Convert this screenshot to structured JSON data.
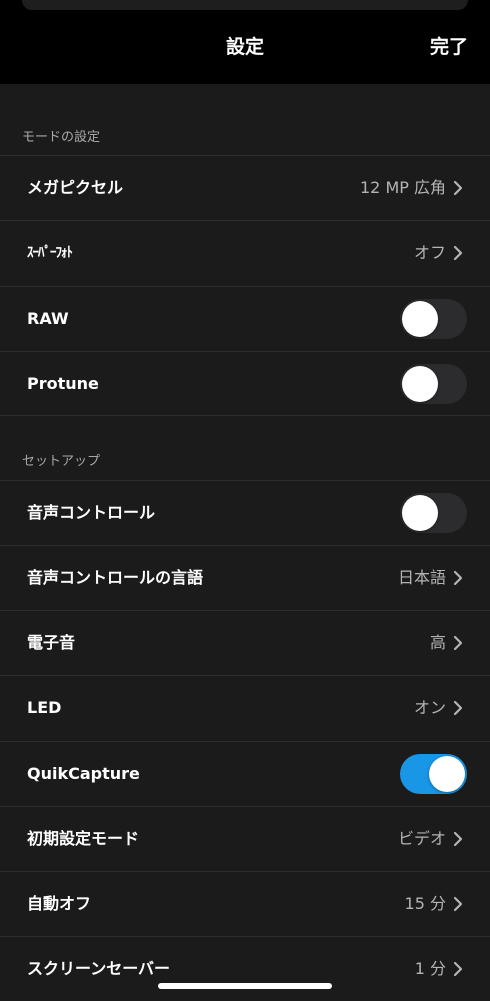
{
  "header": {
    "title": "設定",
    "done_label": "完了"
  },
  "sections": {
    "mode": {
      "title": "モードの設定",
      "rows": [
        {
          "label": "メガピクセル",
          "value": "12 MP 広角"
        },
        {
          "label": "ｽｰﾊﾟｰﾌｫﾄ",
          "value": "オフ"
        },
        {
          "label": "RAW",
          "toggle": false
        },
        {
          "label": "Protune",
          "toggle": false
        }
      ]
    },
    "setup": {
      "title": "セットアップ",
      "rows": [
        {
          "label": "音声コントロール",
          "toggle": false
        },
        {
          "label": "音声コントロールの言語",
          "value": "日本語"
        },
        {
          "label": "電子音",
          "value": "高"
        },
        {
          "label": "LED",
          "value": "オン"
        },
        {
          "label": "QuikCapture",
          "toggle": true
        },
        {
          "label": "初期設定モード",
          "value": "ビデオ"
        },
        {
          "label": "自動オフ",
          "value": "15 分"
        },
        {
          "label": "スクリーンセーバー",
          "value": "1 分"
        }
      ]
    }
  },
  "colors": {
    "background": "#1b1b1b",
    "header": "#000000",
    "toggle_on": "#1a96e6",
    "toggle_off": "#2c2c2e",
    "value_text": "#b4b4b4",
    "section_text": "#a8a8a8"
  }
}
